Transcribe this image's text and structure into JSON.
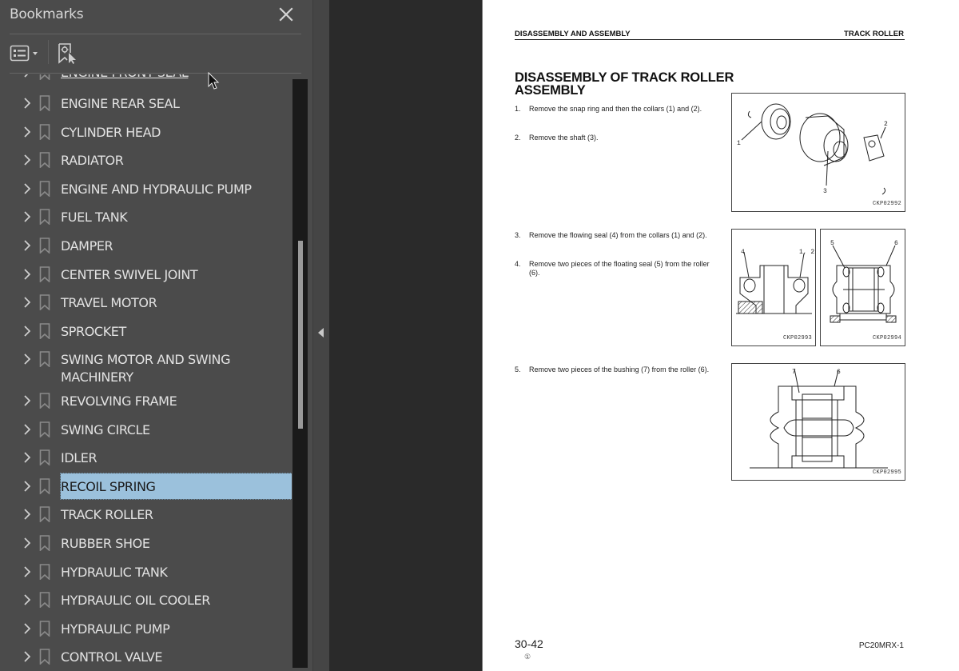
{
  "sidebar": {
    "title": "Bookmarks",
    "close_icon": "close-icon",
    "toolbar": {
      "options_icon": "list-options-icon",
      "options_dropdown_icon": "caret-down-icon",
      "find_current_bookmark_icon": "find-bookmark-icon"
    },
    "partial_item_label": "ENGINE FRONT SEAL",
    "items": [
      {
        "label": "ENGINE REAR SEAL"
      },
      {
        "label": "CYLINDER HEAD"
      },
      {
        "label": "RADIATOR"
      },
      {
        "label": "ENGINE AND HYDRAULIC PUMP"
      },
      {
        "label": "FUEL TANK"
      },
      {
        "label": "DAMPER"
      },
      {
        "label": "CENTER SWIVEL JOINT"
      },
      {
        "label": "TRAVEL MOTOR"
      },
      {
        "label": "SPROCKET"
      },
      {
        "label": "SWING MOTOR AND SWING MACHINERY"
      },
      {
        "label": "REVOLVING FRAME"
      },
      {
        "label": "SWING CIRCLE"
      },
      {
        "label": "IDLER"
      },
      {
        "label": "RECOIL SPRING",
        "selected": true
      },
      {
        "label": "TRACK ROLLER"
      },
      {
        "label": "RUBBER SHOE"
      },
      {
        "label": "HYDRAULIC TANK"
      },
      {
        "label": "HYDRAULIC OIL COOLER"
      },
      {
        "label": "HYDRAULIC PUMP"
      },
      {
        "label": "CONTROL VALVE"
      }
    ],
    "selection_color": "#9bc1dc"
  },
  "page": {
    "running_header_left": "DISASSEMBLY AND ASSEMBLY",
    "running_header_right": "TRACK ROLLER",
    "title": "DISASSEMBLY OF TRACK ROLLER ASSEMBLY",
    "steps": [
      {
        "num": "1.",
        "text": "Remove the snap ring and then the collars (1) and (2)."
      },
      {
        "num": "2.",
        "text": "Remove the shaft (3)."
      },
      {
        "num": "3.",
        "text": "Remove the flowing seal (4) from the collars (1) and (2)."
      },
      {
        "num": "4.",
        "text": "Remove two pieces of the floating seal (5) from the roller (6)."
      },
      {
        "num": "5.",
        "text": "Remove two pieces of the bushing (7) from the roller (6)."
      }
    ],
    "figures": [
      {
        "code": "CKP02992",
        "callouts": [
          "1",
          "2",
          "3"
        ]
      },
      {
        "code": "CKP02993",
        "callouts": [
          "4",
          "1, 2"
        ]
      },
      {
        "code": "CKP02994",
        "callouts": [
          "5",
          "6"
        ]
      },
      {
        "code": "CKP02995",
        "callouts": [
          "7",
          "6"
        ]
      }
    ],
    "page_number": "30-42",
    "revision_mark": "①",
    "model_code": "PC20MRX-1"
  }
}
